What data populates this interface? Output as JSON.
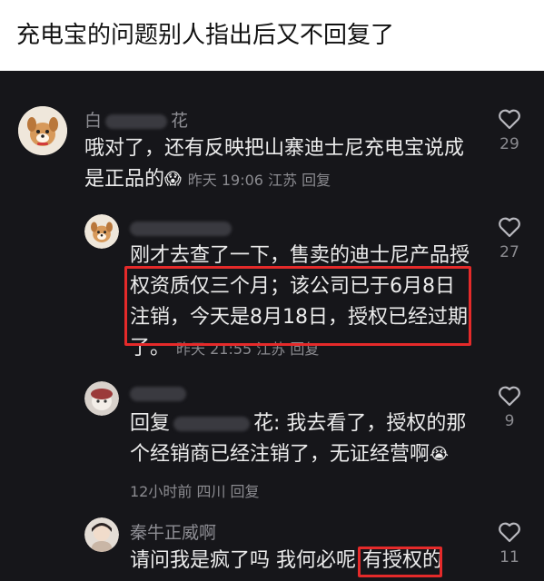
{
  "header": {
    "title": "充电宝的问题别人指出后又不回复了"
  },
  "comments": [
    {
      "name_prefix": "白",
      "name_suffix": "花",
      "text_line1": "哦对了，还有反映把山寨迪士尼充电宝说成",
      "text_line2": "是正品的",
      "emoji": "😱",
      "meta": "昨天 19:06 江苏 回复",
      "likes": "29"
    },
    {
      "name_prefix": "",
      "name_suffix": "",
      "text_line1": "刚才去查了一下，售卖的迪士尼产品授",
      "text_line2": "权资质仅三个月；该公司已于6月8日",
      "text_line3": "注销，今天是8月18日，授权已经过期",
      "text_line4": "了。",
      "meta": "昨天 21:55 江苏 回复",
      "likes": "27"
    },
    {
      "name_prefix": "",
      "name_suffix": "",
      "reply_prefix": "回复",
      "reply_suffix": "花: 我去看了，授权的那",
      "text_line2": "个经销商已经注销了，无证经营啊",
      "emoji": "😭",
      "meta": "12小时前 四川 回复",
      "likes": "9"
    },
    {
      "name": "秦牛正威啊",
      "text_line1": "请问我是疯了吗 我何必呢 ",
      "text_highlight": "有授权的",
      "likes": "11"
    }
  ],
  "icons": {
    "like": "heart-outline-icon"
  },
  "colors": {
    "highlight_box": "#e52a2a",
    "background": "#16161a"
  }
}
